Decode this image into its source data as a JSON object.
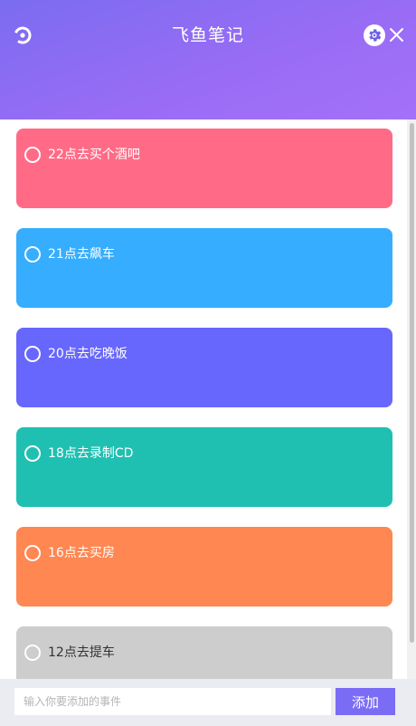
{
  "app": {
    "title": "飞鱼笔记",
    "accent": "#7a6cf5"
  },
  "header": {
    "logo_icon": "power-ring-icon",
    "settings_icon": "gear-icon",
    "close_icon": "close-icon"
  },
  "todos": [
    {
      "text": "22点去买个酒吧",
      "color": "#ff6b87",
      "done": false
    },
    {
      "text": "21点去飙车",
      "color": "#36adfe",
      "done": false
    },
    {
      "text": "20点去吃晚饭",
      "color": "#6767fd",
      "done": false
    },
    {
      "text": "18点去录制CD",
      "color": "#1fc0b1",
      "done": false
    },
    {
      "text": "16点去买房",
      "color": "#ff8752",
      "done": false
    },
    {
      "text": "12点去提车",
      "color": "#cdcdcd",
      "done": true
    }
  ],
  "footer": {
    "input_value": "",
    "input_placeholder": "输入你要添加的事件",
    "add_label": "添加"
  }
}
